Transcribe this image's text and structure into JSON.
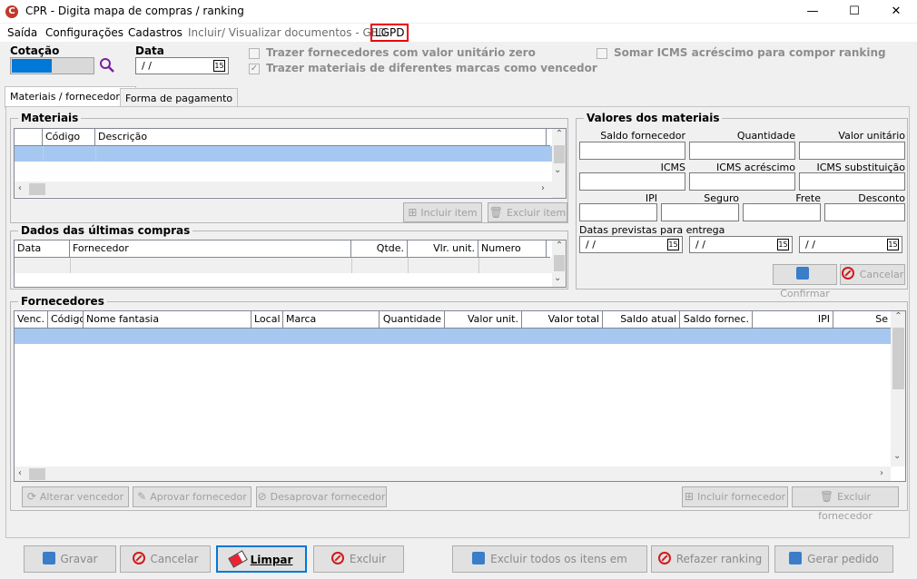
{
  "window": {
    "title": "CPR - Digita mapa de compras / ranking",
    "minimize": "—",
    "maximize": "☐",
    "close": "✕"
  },
  "menu": [
    "Saída",
    "Configurações",
    "Cadastros",
    "Incluir/ Visualizar documentos - GED",
    "LGPD"
  ],
  "header": {
    "cotacao_label": "Cotação",
    "data_label": "Data",
    "data_value": "/ /",
    "chk_fornecedores": "Trazer fornecedores com valor unitário zero",
    "chk_materiais": "Trazer materiais de diferentes marcas como vencedor",
    "chk_icms": "Somar ICMS acréscimo para compor ranking"
  },
  "tabs": [
    "Materiais / fornecedores",
    "Forma de pagamento"
  ],
  "materiais": {
    "title": "Materiais",
    "columns": [
      "Código",
      "Descrição"
    ],
    "incluir": "Incluir item",
    "excluir": "Excluir item"
  },
  "ultimas": {
    "title": "Dados das últimas compras",
    "columns": [
      "Data",
      "Fornecedor",
      "Qtde.",
      "Vlr. unit.",
      "Numero"
    ]
  },
  "valores": {
    "title": "Valores dos materiais",
    "row1": [
      "Saldo fornecedor",
      "Quantidade",
      "Valor unitário"
    ],
    "row2": [
      "ICMS",
      "ICMS acréscimo",
      "ICMS substituição"
    ],
    "row3": [
      "IPI",
      "Seguro",
      "Frete",
      "Desconto"
    ],
    "datas_label": "Datas previstas para entrega",
    "datas": [
      "/ /",
      "/ /",
      "/ /"
    ],
    "confirmar": "Confirmar",
    "cancelar": "Cancelar"
  },
  "fornecedores": {
    "title": "Fornecedores",
    "columns": [
      "Venc.",
      "Código",
      "Nome fantasia",
      "Local",
      "Marca",
      "Quantidade",
      "Valor unit.",
      "Valor total",
      "Saldo atual",
      "Saldo fornec.",
      "IPI",
      "Se"
    ],
    "alterar": "Alterar vencedor",
    "aprovar": "Aprovar fornecedor",
    "desaprovar": "Desaprovar fornecedor",
    "incluir": "Incluir fornecedor",
    "excluir": "Excluir fornecedor"
  },
  "footer": {
    "gravar": "Gravar",
    "cancelar": "Cancelar",
    "limpar": "Limpar",
    "excluir": "Excluir",
    "excluir_todos": "Excluir todos os itens em aberto",
    "refazer": "Refazer ranking",
    "gerar": "Gerar pedido"
  },
  "calendar_icon_text": "15",
  "colors": {
    "selection": "#a6c8f0",
    "highlight": "#e00000",
    "accent": "#0078d7"
  }
}
